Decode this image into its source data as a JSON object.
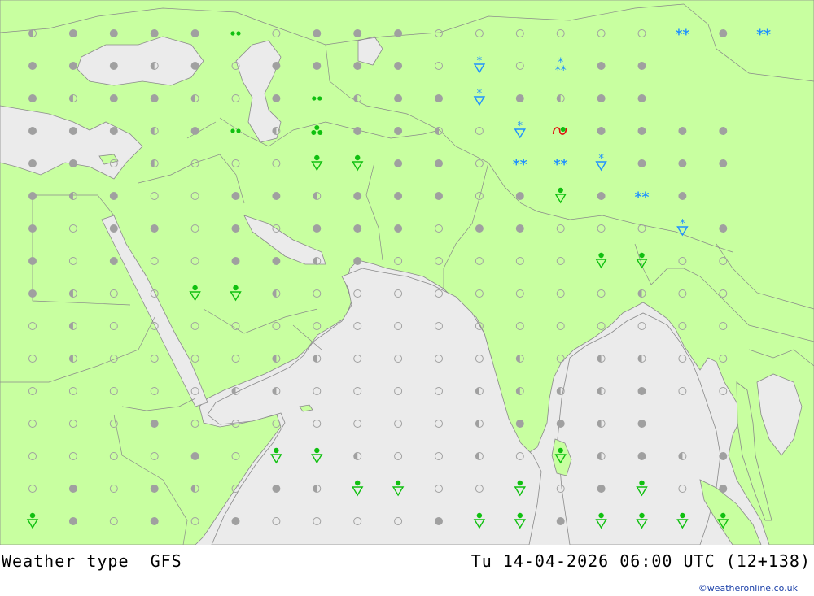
{
  "footer": {
    "title": "Weather type  GFS",
    "datetime": "Tu 14-04-2026 06:00 UTC (12+138)",
    "credit": "©weatheronline.co.uk"
  },
  "colors": {
    "land": "#c8ffa0",
    "sea": "#ebebeb",
    "border": "#8a8a8a",
    "symbol_grey": "#a0a0a0",
    "rain_green": "#10c010",
    "snow_blue": "#1e90ff",
    "storm_red": "#e01010"
  },
  "legend_symbols": {
    "c": "clear-sky-open-circle",
    "h": "partly-cloudy-half-circle",
    "f": "overcast-filled-circle",
    "r": "rain-shower-triangle",
    "d": "drizzle-double-dot",
    "t": "rain-triple-dot",
    "s": "snow-shower-triangle",
    "w": "snow-double-asterisk",
    "x": "snow-stacked-asterisk",
    "m": "thunderstorm-mixed"
  },
  "weather_grid": [
    "hffffdcfffccccccwfw",
    "fffhfcffffcscxff",
    "fhffhcfdhffsfhff",
    "fffhfdhtffhcsmffff",
    "ffchcccrrffcwwsfff",
    "fhfccffhfffcfrfwf",
    "fcffcfcfffcffcccsf",
    "fcfccffhfcccccrrcc",
    "fhccrrhcccccccchcc",
    "chcccccccccccccccc",
    "chcccchhcccchchhcc",
    "ccccchhcccchhhhfcc",
    "cccfccccccchffhf",
    "ccccfcrrhcchcrhfhf",
    "cfcfhcfhrrccrcfrcf",
    "rfcfcfccccfrrfrrrr"
  ]
}
